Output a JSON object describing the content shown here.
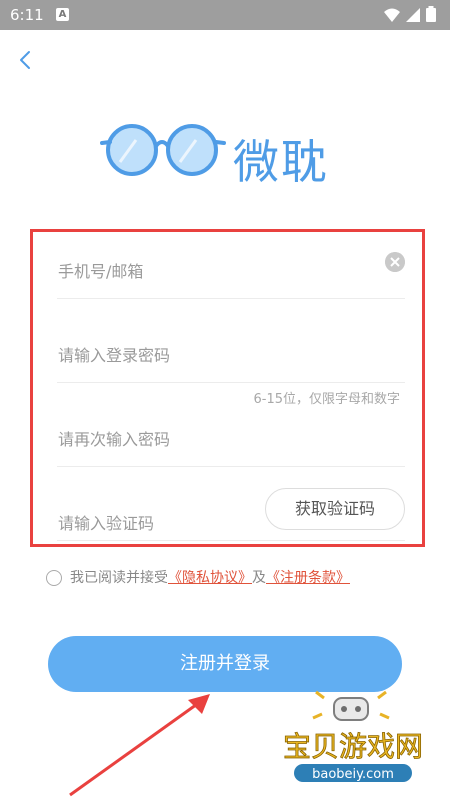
{
  "status_bar": {
    "time": "6:11",
    "badge": "A"
  },
  "header": {
    "back_icon": "chevron-left-icon"
  },
  "logo": {
    "icon": "glasses-logo-icon",
    "text": "微耽"
  },
  "form": {
    "account": {
      "placeholder": "手机号/邮箱",
      "clear_icon": "clear-icon"
    },
    "password": {
      "placeholder": "请输入登录密码",
      "hint": "6-15位，仅限字母和数字"
    },
    "confirm_password": {
      "placeholder": "请再次输入密码"
    },
    "verification": {
      "placeholder": "请输入验证码",
      "button": "获取验证码"
    }
  },
  "agreement": {
    "prefix": "我已阅读并接受",
    "privacy_link": "《隐私协议》",
    "middle": "及",
    "terms_link": "《注册条款》"
  },
  "submit": {
    "label": "注册并登录"
  },
  "watermark": {
    "title": "宝贝游戏网",
    "url": "baobeiy.com"
  },
  "colors": {
    "accent": "#61aef2",
    "logo": "#4f9ce6",
    "highlight_border": "#e9413f",
    "link": "#e0533b"
  }
}
